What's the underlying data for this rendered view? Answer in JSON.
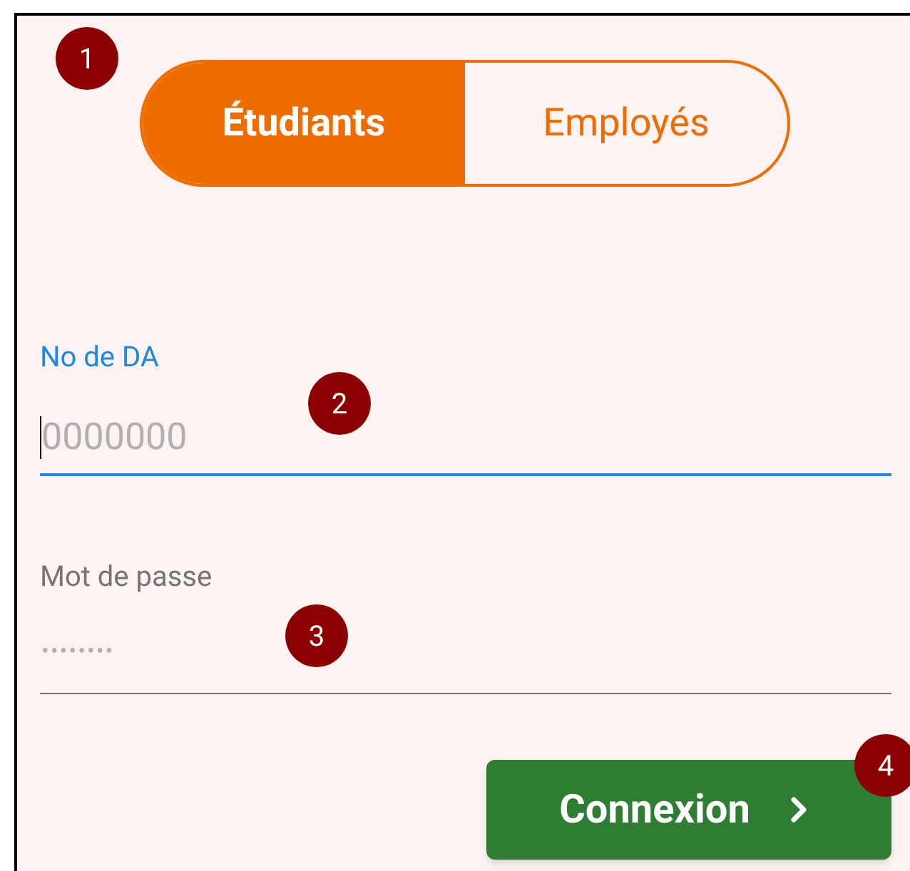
{
  "toggle": [
    {
      "label": "Étudiants",
      "selected": true
    },
    {
      "label": "Employés",
      "selected": false
    }
  ],
  "fields": [
    {
      "label": "No de DA",
      "placeholder": "0000000",
      "focused": true
    },
    {
      "label": "Mot de passe",
      "placeholder": "••••••••",
      "focused": false
    }
  ],
  "button": {
    "label": "Connexion"
  },
  "markers": [
    "1",
    "2",
    "3",
    "4"
  ]
}
